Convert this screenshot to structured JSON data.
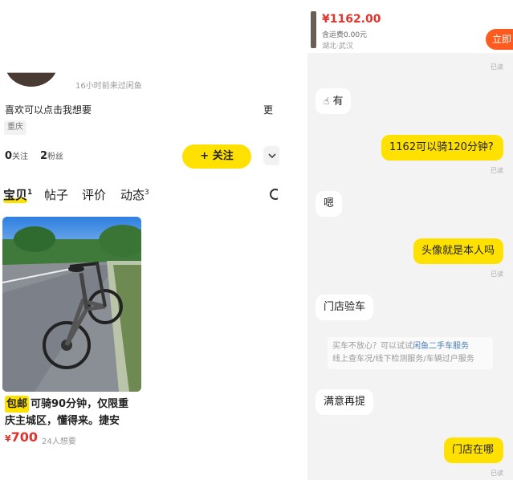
{
  "profile": {
    "last_seen": "16小时前来过闲鱼",
    "bio": "喜欢可以点击我想要",
    "bio_more": "更",
    "city": "重庆",
    "follows_count": "0",
    "follows_label": "关注",
    "fans_count": "2",
    "fans_label": "粉丝",
    "follow_button": "+ 关注"
  },
  "tabs": [
    {
      "label": "宝贝",
      "count": "1",
      "active": true
    },
    {
      "label": "帖子",
      "count": ""
    },
    {
      "label": "评价",
      "count": ""
    },
    {
      "label": "动态",
      "count": "3"
    }
  ],
  "listing": {
    "badge": "包邮",
    "line1": "可骑90分钟，仅限重",
    "line2": "庆主城区，懂得来。捷安",
    "currency": "¥",
    "price": "700",
    "wants": "24人想要"
  },
  "chat": {
    "item_price": "¥1162.00",
    "item_shipping": "含运费0.00元",
    "item_location": "湖北·武汉",
    "buy_button": "立即",
    "read_label": "已读",
    "messages": [
      {
        "side": "in",
        "text": "有",
        "icon": "pointing-hand-icon"
      },
      {
        "side": "out",
        "text": "1162可以骑120分钟?"
      },
      {
        "side": "in",
        "text": "嗯"
      },
      {
        "side": "out",
        "text": "头像就是本人吗"
      },
      {
        "side": "in",
        "text": "门店验车"
      },
      {
        "side": "in",
        "text": "满意再提"
      },
      {
        "side": "out",
        "text": "门店在哪"
      }
    ],
    "system_notice": {
      "prefix": "买车不放心？可以试试",
      "link": "闲鱼二手车服务",
      "line2": "线上查车况/线下检测服务/车辆过户服务"
    }
  },
  "colors": {
    "accent_yellow": "#ffe100",
    "price_red": "#e0342e",
    "buy_orange": "#ff5a1f"
  }
}
